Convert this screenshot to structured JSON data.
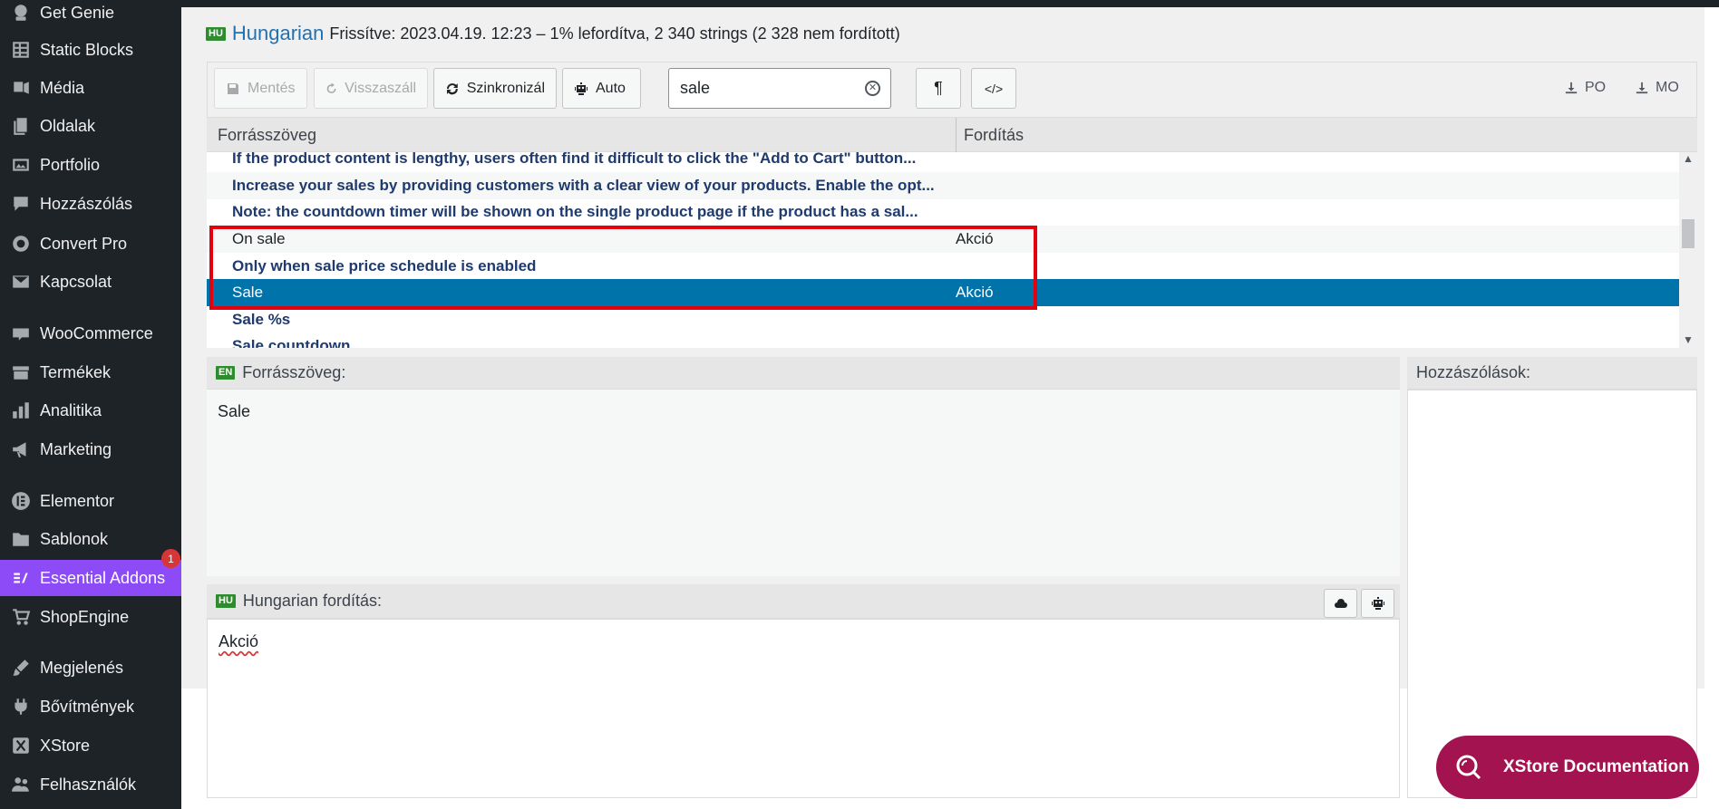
{
  "sidebar": {
    "items": [
      {
        "label": "Get Genie",
        "icon": "genie-icon"
      },
      {
        "label": "Static Blocks",
        "icon": "table-icon"
      },
      {
        "label": "Média",
        "icon": "media-icon"
      },
      {
        "label": "Oldalak",
        "icon": "pages-icon"
      },
      {
        "label": "Portfolio",
        "icon": "portfolio-icon"
      },
      {
        "label": "Hozzászólás",
        "icon": "comment-icon"
      },
      {
        "label": "Convert Pro",
        "icon": "convert-pro-icon"
      },
      {
        "label": "Kapcsolat",
        "icon": "mail-icon"
      },
      {
        "label": "WooCommerce",
        "icon": "woo-icon"
      },
      {
        "label": "Termékek",
        "icon": "archive-icon"
      },
      {
        "label": "Analitika",
        "icon": "bar-chart-icon"
      },
      {
        "label": "Marketing",
        "icon": "megaphone-icon"
      },
      {
        "label": "Elementor",
        "icon": "elementor-icon"
      },
      {
        "label": "Sablonok",
        "icon": "folder-icon"
      },
      {
        "label": "Essential Addons",
        "icon": "essential-addons-icon",
        "badge": "1"
      },
      {
        "label": "ShopEngine",
        "icon": "shopengine-icon"
      },
      {
        "label": "Megjelenés",
        "icon": "brush-icon"
      },
      {
        "label": "Bővítmények",
        "icon": "plugin-icon"
      },
      {
        "label": "XStore",
        "icon": "xstore-icon"
      },
      {
        "label": "Felhasználók",
        "icon": "users-icon"
      }
    ]
  },
  "header": {
    "flag": "HU",
    "language": "Hungarian",
    "meta": "Frissítve: 2023.04.19. 12:23 – 1% lefordítva, 2 340 strings (2 328 nem fordított)"
  },
  "toolbar": {
    "save": "Mentés",
    "revert": "Visszaszáll",
    "sync": "Szinkronizál",
    "auto": "Auto",
    "search_value": "sale",
    "po": "PO",
    "mo": "MO"
  },
  "list": {
    "col_source": "Forrásszöveg",
    "col_translation": "Fordítás",
    "rows": [
      {
        "source": "If the product content is lengthy, users often find it difficult to click the \"Add to Cart\" button...",
        "translation": ""
      },
      {
        "source": "Increase your sales by providing customers with a clear view of your products. Enable the opt...",
        "translation": ""
      },
      {
        "source": "Note: the countdown timer will be shown on the single product page if the product has a sal...",
        "translation": ""
      },
      {
        "source": "On sale",
        "translation": "Akció"
      },
      {
        "source": "Only when sale price schedule is enabled",
        "translation": ""
      },
      {
        "source": "Sale",
        "translation": "Akció"
      },
      {
        "source": "Sale %s",
        "translation": ""
      },
      {
        "source": "Sale countdown",
        "translation": ""
      }
    ]
  },
  "source_pane": {
    "flag": "EN",
    "label": "Forrásszöveg:",
    "text": "Sale"
  },
  "translation_pane": {
    "flag": "HU",
    "label": "Hungarian fordítás:",
    "text": "Akció"
  },
  "comments_pane": {
    "label": "Hozzászólások:"
  },
  "doc_button": {
    "label": "XStore Documentation"
  },
  "colors": {
    "sidebar_bg": "#1d2327",
    "active_item": "#8c4bf6",
    "selected_row": "#0073aa",
    "link": "#2271b1",
    "highlight_border": "#e3000f",
    "doc_button": "#a3134f"
  }
}
